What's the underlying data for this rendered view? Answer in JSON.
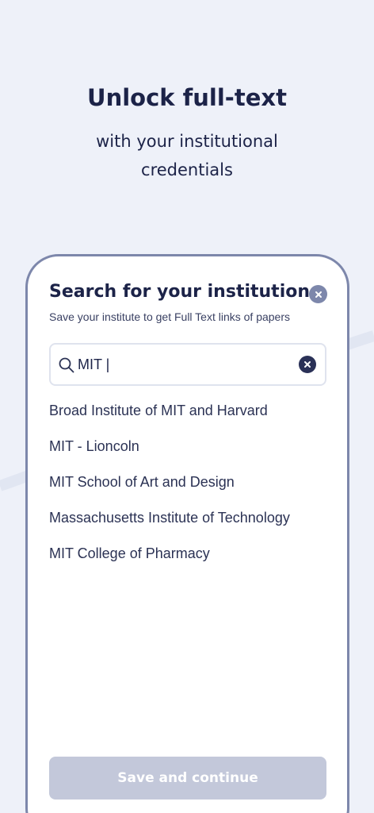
{
  "hero": {
    "title": "Unlock full-text",
    "subtitle": "with your institutional credentials"
  },
  "modal": {
    "title": "Search for your institution",
    "subtitle": "Save your institute to get Full Text links of papers",
    "close_icon": "close-icon"
  },
  "search": {
    "value": "MIT |",
    "icon": "search-icon",
    "clear_icon": "clear-icon"
  },
  "results": [
    "Broad Institute of MIT and Harvard",
    "MIT - Lioncoln",
    "MIT School of Art and Design",
    "Massachusetts Institute of Technology",
    "MIT College of Pharmacy"
  ],
  "actions": {
    "save_label": "Save and continue"
  },
  "colors": {
    "background": "#eef1f9",
    "text": "#1c2348",
    "card_border": "#7d87ab",
    "button_disabled": "#c3c8da",
    "clear_button": "#2a3157"
  }
}
